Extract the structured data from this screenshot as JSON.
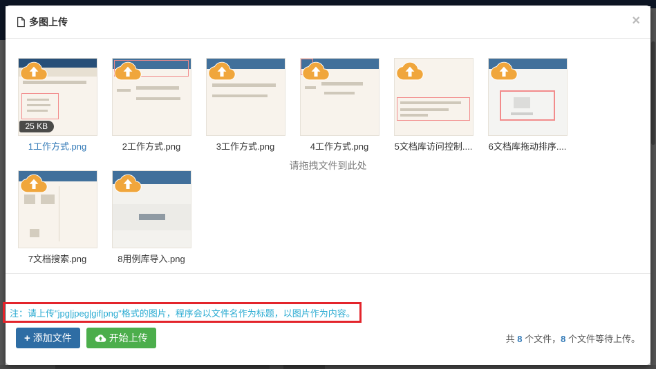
{
  "modal": {
    "title": "多图上传",
    "close_label": "×"
  },
  "dropzone_hint": "请拖拽文件到此处",
  "files": [
    {
      "name": "1工作方式.png",
      "size": "25 KB",
      "link": true,
      "variant": "v1"
    },
    {
      "name": "2工作方式.png",
      "link": false,
      "variant": "v2"
    },
    {
      "name": "3工作方式.png",
      "link": false,
      "variant": "v3"
    },
    {
      "name": "4工作方式.png",
      "link": false,
      "variant": "v4"
    },
    {
      "name": "5文档库访问控制....",
      "link": false,
      "variant": "v5"
    },
    {
      "name": "6文档库拖动排序....",
      "link": false,
      "variant": "v6"
    },
    {
      "name": "7文档搜索.png",
      "link": false,
      "variant": "v7"
    },
    {
      "name": "8用例库导入.png",
      "link": false,
      "variant": "v8"
    }
  ],
  "note": "注：请上传\"jpg|jpeg|gif|png\"格式的图片，程序会以文件名作为标题，以图片作为内容。",
  "footer": {
    "add_label": "添加文件",
    "upload_label": "开始上传",
    "status": {
      "prefix": "共 ",
      "count_total": "8",
      "between": " 个文件，",
      "count_pending": "8",
      "suffix": " 个文件等待上传。"
    }
  },
  "colors": {
    "link": "#337ab7",
    "note": "#2aabd2",
    "annotation": "#e3242b",
    "cloud": "#f0a63c",
    "btn-add": "#2e6da4",
    "btn-upload": "#4cae4c",
    "navy": "#0d1524"
  }
}
